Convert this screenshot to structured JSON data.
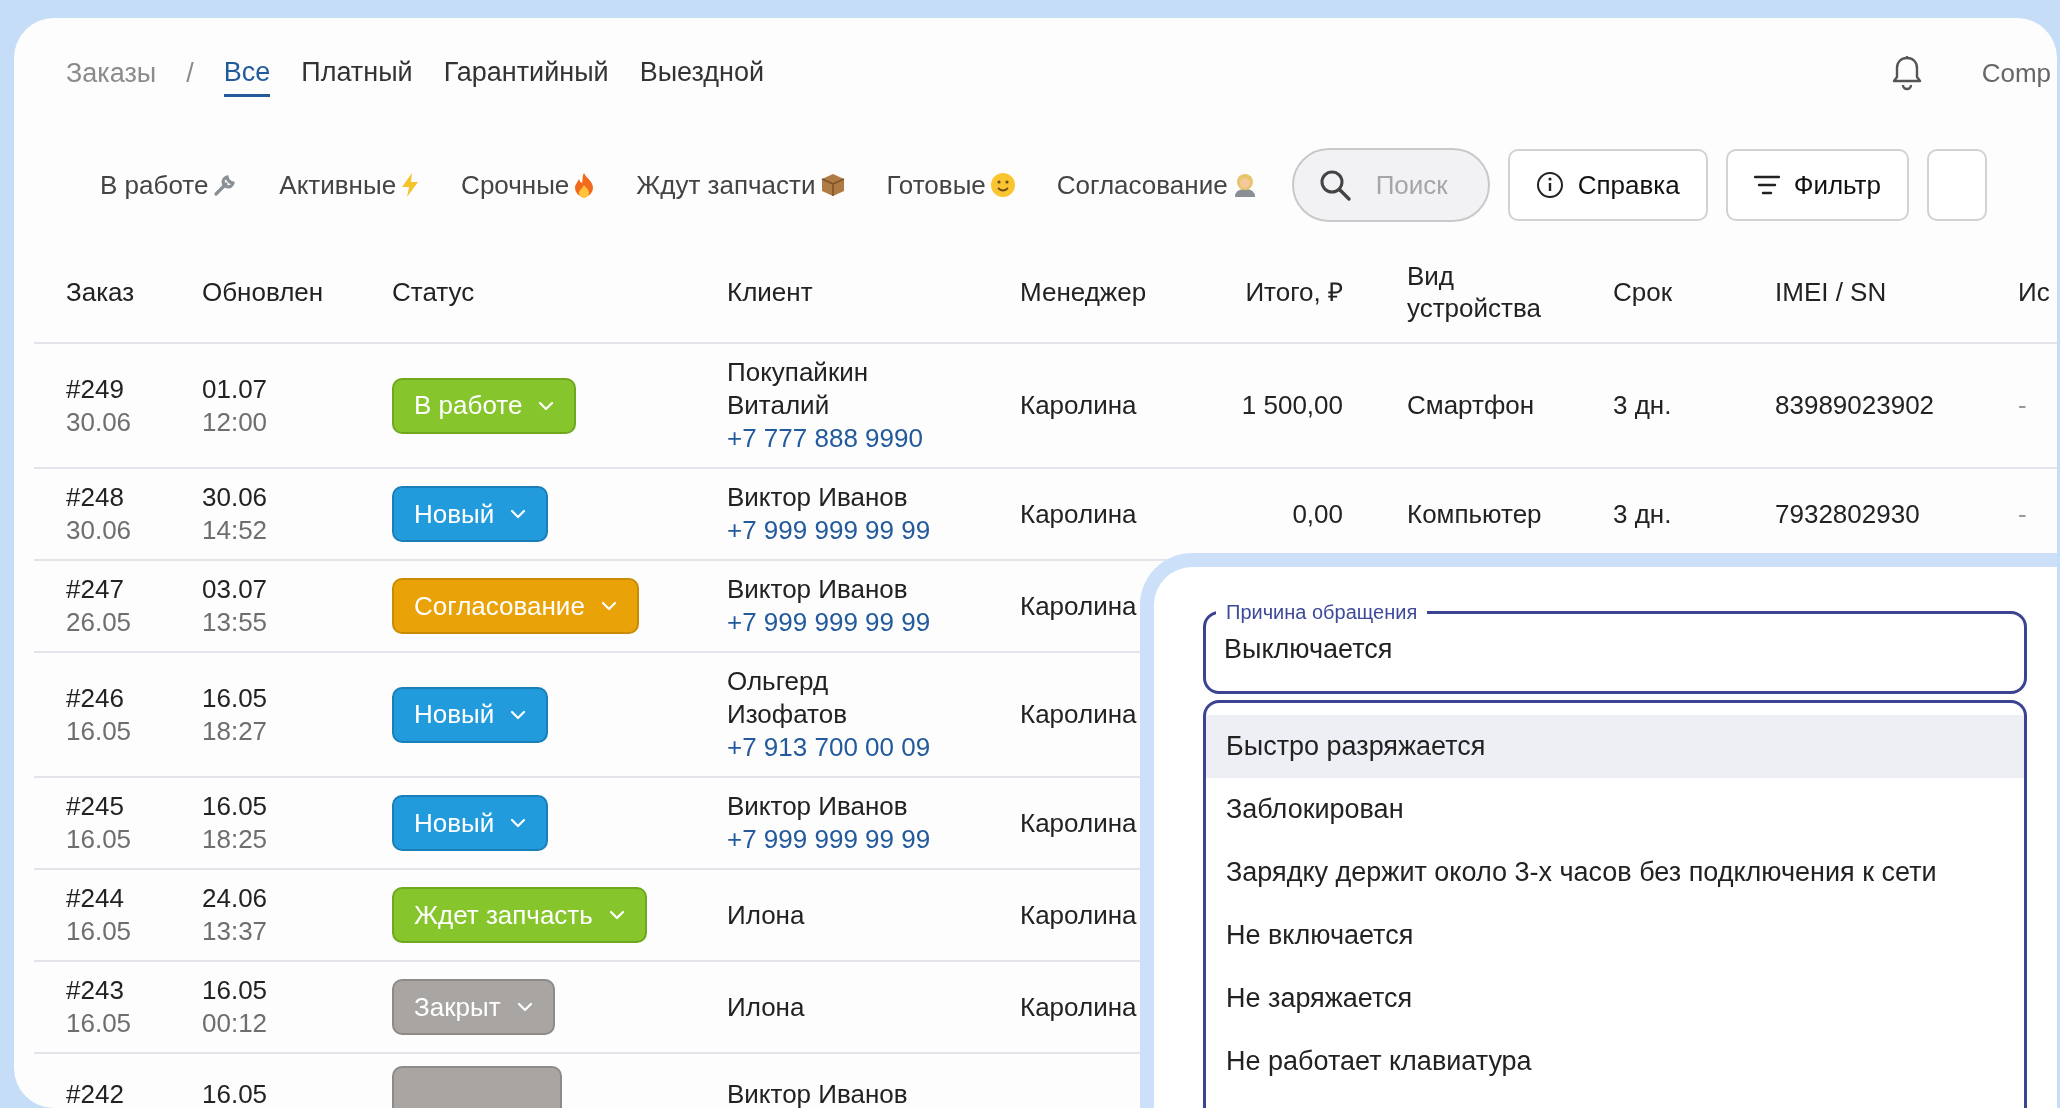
{
  "breadcrumb": {
    "root": "Заказы",
    "separator": "/"
  },
  "tabs": [
    {
      "label": "Все",
      "selected": true
    },
    {
      "label": "Платный",
      "selected": false
    },
    {
      "label": "Гарантийный",
      "selected": false
    },
    {
      "label": "Выездной",
      "selected": false
    }
  ],
  "user": {
    "name": "Comp"
  },
  "filters": [
    {
      "label": "В работе"
    },
    {
      "label": "Активные"
    },
    {
      "label": "Срочные"
    },
    {
      "label": "Ждут запчасти"
    },
    {
      "label": "Готовые"
    },
    {
      "label": "Согласование"
    }
  ],
  "search": {
    "placeholder": "Поиск"
  },
  "buttons": [
    "Справка",
    "Фильтр"
  ],
  "table": {
    "columns": [
      "Заказ",
      "Обновлен",
      "Статус",
      "Клиент",
      "Менеджер",
      "Итого, ₽",
      "Вид устройства",
      "Срок",
      "IMEI / SN",
      "Ис"
    ],
    "rows": [
      {
        "order": "#249",
        "created": "30.06",
        "updated_date": "01.07",
        "updated_time": "12:00",
        "status": {
          "label": "В работе",
          "kind": "in_progress"
        },
        "client": "Покупайкин Виталий",
        "phone": "+7 777 888 9990",
        "manager": "Каролина",
        "total": "1 500,00",
        "device": "Смартфон",
        "term": "3 дн.",
        "imei": "83989023902",
        "column_10": "-"
      },
      {
        "order": "#248",
        "created": "30.06",
        "updated_date": "30.06",
        "updated_time": "14:52",
        "status": {
          "label": "Новый",
          "kind": "new"
        },
        "client": "Виктор Иванов",
        "phone": "+7 999 999 99 99",
        "manager": "Каролина",
        "total": "0,00",
        "device": "Компьютер",
        "term": "3 дн.",
        "imei": "7932802930",
        "column_10": "-"
      },
      {
        "order": "#247",
        "created": "26.05",
        "updated_date": "03.07",
        "updated_time": "13:55",
        "status": {
          "label": "Согласование",
          "kind": "approval"
        },
        "client": "Виктор Иванов",
        "phone": "+7 999 999 99 99",
        "manager": "Каролина"
      },
      {
        "order": "#246",
        "created": "16.05",
        "updated_date": "16.05",
        "updated_time": "18:27",
        "status": {
          "label": "Новый",
          "kind": "new"
        },
        "client": "Ольгерд Изофатов",
        "phone": "+7 913 700 00 09",
        "manager": "Каролина"
      },
      {
        "order": "#245",
        "created": "16.05",
        "updated_date": "16.05",
        "updated_time": "18:25",
        "status": {
          "label": "Новый",
          "kind": "new"
        },
        "client": "Виктор Иванов",
        "phone": "+7 999 999 99 99",
        "manager": "Каролина"
      },
      {
        "order": "#244",
        "created": "16.05",
        "updated_date": "24.06",
        "updated_time": "13:37",
        "status": {
          "label": "Ждет запчасть",
          "kind": "waiting_parts"
        },
        "client": "Илона",
        "manager": "Каролина"
      },
      {
        "order": "#243",
        "created": "16.05",
        "updated_date": "16.05",
        "updated_time": "00:12",
        "status": {
          "label": "Закрыт",
          "kind": "closed"
        },
        "client": "Илона",
        "manager": "Каролина"
      },
      {
        "order": "#242",
        "updated_date": "16.05",
        "status": {
          "kind": "closed"
        },
        "client": "Виктор Иванов"
      }
    ]
  },
  "reason_popup": {
    "field": {
      "label": "Причина обращения",
      "value": "Выключается"
    },
    "options": [
      {
        "label": "Быстро разряжается",
        "selected": true
      },
      {
        "label": "Заблокирован",
        "selected": false
      },
      {
        "label": "Зарядку держит около 3-х часов без подключения к сети",
        "selected": false
      },
      {
        "label": "Не включается",
        "selected": false
      },
      {
        "label": "Не заряжается",
        "selected": false
      },
      {
        "label": "Не работает клавиатура",
        "selected": false
      }
    ]
  }
}
